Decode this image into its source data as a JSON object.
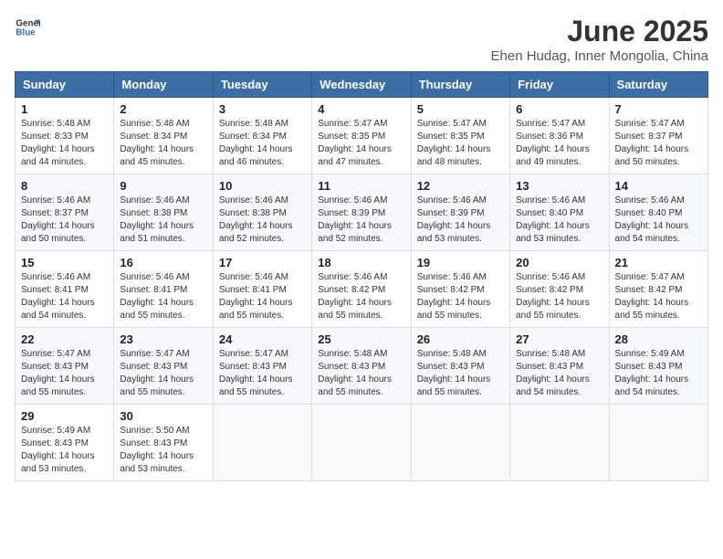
{
  "header": {
    "logo_general": "General",
    "logo_blue": "Blue",
    "title": "June 2025",
    "subtitle": "Ehen Hudag, Inner Mongolia, China"
  },
  "calendar": {
    "weekdays": [
      "Sunday",
      "Monday",
      "Tuesday",
      "Wednesday",
      "Thursday",
      "Friday",
      "Saturday"
    ],
    "weeks": [
      [
        null,
        null,
        null,
        null,
        null,
        null,
        {
          "day": 1,
          "sunrise": "5:47 AM",
          "sunset": "8:37 PM",
          "daylight": "14 hours and 50 minutes."
        }
      ],
      [
        {
          "day": 1,
          "sunrise": "5:48 AM",
          "sunset": "8:33 PM",
          "daylight": "14 hours and 44 minutes."
        },
        {
          "day": 2,
          "sunrise": "5:48 AM",
          "sunset": "8:34 PM",
          "daylight": "14 hours and 45 minutes."
        },
        {
          "day": 3,
          "sunrise": "5:48 AM",
          "sunset": "8:34 PM",
          "daylight": "14 hours and 46 minutes."
        },
        {
          "day": 4,
          "sunrise": "5:47 AM",
          "sunset": "8:35 PM",
          "daylight": "14 hours and 47 minutes."
        },
        {
          "day": 5,
          "sunrise": "5:47 AM",
          "sunset": "8:35 PM",
          "daylight": "14 hours and 48 minutes."
        },
        {
          "day": 6,
          "sunrise": "5:47 AM",
          "sunset": "8:36 PM",
          "daylight": "14 hours and 49 minutes."
        },
        {
          "day": 7,
          "sunrise": "5:47 AM",
          "sunset": "8:37 PM",
          "daylight": "14 hours and 50 minutes."
        }
      ],
      [
        {
          "day": 8,
          "sunrise": "5:46 AM",
          "sunset": "8:37 PM",
          "daylight": "14 hours and 50 minutes."
        },
        {
          "day": 9,
          "sunrise": "5:46 AM",
          "sunset": "8:38 PM",
          "daylight": "14 hours and 51 minutes."
        },
        {
          "day": 10,
          "sunrise": "5:46 AM",
          "sunset": "8:38 PM",
          "daylight": "14 hours and 52 minutes."
        },
        {
          "day": 11,
          "sunrise": "5:46 AM",
          "sunset": "8:39 PM",
          "daylight": "14 hours and 52 minutes."
        },
        {
          "day": 12,
          "sunrise": "5:46 AM",
          "sunset": "8:39 PM",
          "daylight": "14 hours and 53 minutes."
        },
        {
          "day": 13,
          "sunrise": "5:46 AM",
          "sunset": "8:40 PM",
          "daylight": "14 hours and 53 minutes."
        },
        {
          "day": 14,
          "sunrise": "5:46 AM",
          "sunset": "8:40 PM",
          "daylight": "14 hours and 54 minutes."
        }
      ],
      [
        {
          "day": 15,
          "sunrise": "5:46 AM",
          "sunset": "8:41 PM",
          "daylight": "14 hours and 54 minutes."
        },
        {
          "day": 16,
          "sunrise": "5:46 AM",
          "sunset": "8:41 PM",
          "daylight": "14 hours and 55 minutes."
        },
        {
          "day": 17,
          "sunrise": "5:46 AM",
          "sunset": "8:41 PM",
          "daylight": "14 hours and 55 minutes."
        },
        {
          "day": 18,
          "sunrise": "5:46 AM",
          "sunset": "8:42 PM",
          "daylight": "14 hours and 55 minutes."
        },
        {
          "day": 19,
          "sunrise": "5:46 AM",
          "sunset": "8:42 PM",
          "daylight": "14 hours and 55 minutes."
        },
        {
          "day": 20,
          "sunrise": "5:46 AM",
          "sunset": "8:42 PM",
          "daylight": "14 hours and 55 minutes."
        },
        {
          "day": 21,
          "sunrise": "5:47 AM",
          "sunset": "8:42 PM",
          "daylight": "14 hours and 55 minutes."
        }
      ],
      [
        {
          "day": 22,
          "sunrise": "5:47 AM",
          "sunset": "8:43 PM",
          "daylight": "14 hours and 55 minutes."
        },
        {
          "day": 23,
          "sunrise": "5:47 AM",
          "sunset": "8:43 PM",
          "daylight": "14 hours and 55 minutes."
        },
        {
          "day": 24,
          "sunrise": "5:47 AM",
          "sunset": "8:43 PM",
          "daylight": "14 hours and 55 minutes."
        },
        {
          "day": 25,
          "sunrise": "5:48 AM",
          "sunset": "8:43 PM",
          "daylight": "14 hours and 55 minutes."
        },
        {
          "day": 26,
          "sunrise": "5:48 AM",
          "sunset": "8:43 PM",
          "daylight": "14 hours and 55 minutes."
        },
        {
          "day": 27,
          "sunrise": "5:48 AM",
          "sunset": "8:43 PM",
          "daylight": "14 hours and 54 minutes."
        },
        {
          "day": 28,
          "sunrise": "5:49 AM",
          "sunset": "8:43 PM",
          "daylight": "14 hours and 54 minutes."
        }
      ],
      [
        {
          "day": 29,
          "sunrise": "5:49 AM",
          "sunset": "8:43 PM",
          "daylight": "14 hours and 53 minutes."
        },
        {
          "day": 30,
          "sunrise": "5:50 AM",
          "sunset": "8:43 PM",
          "daylight": "14 hours and 53 minutes."
        },
        null,
        null,
        null,
        null,
        null
      ]
    ]
  }
}
